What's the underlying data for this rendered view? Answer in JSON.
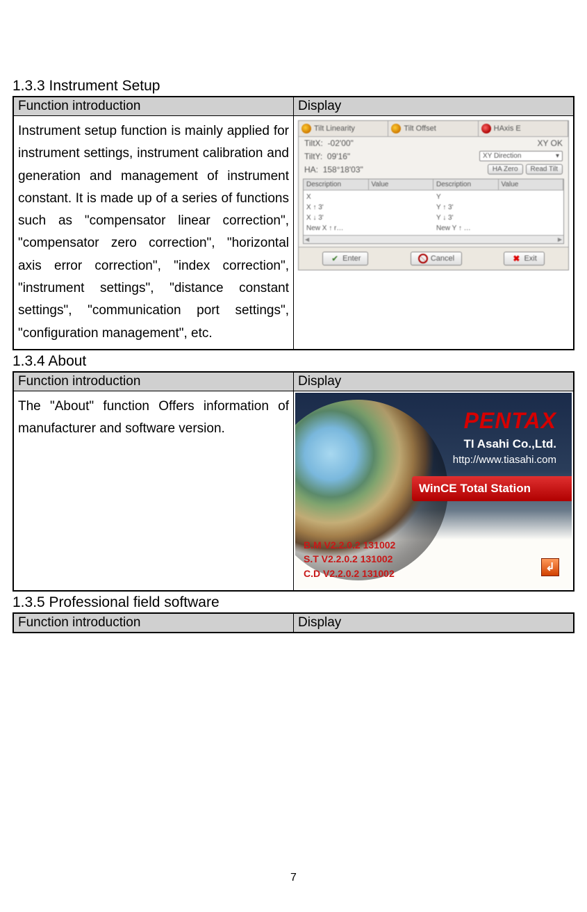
{
  "sections": {
    "s1": {
      "heading": "1.3.3 Instrument Setup",
      "th1": "Function introduction",
      "th2": "Display",
      "intro": "Instrument setup function is mainly applied for instrument settings, instrument calibration and generation and management of instrument constant. It is made up of a series of functions such as \"compensator linear correction\", \"compensator zero correction\", \"horizontal axis error correction\", \"index correction\", \"instrument settings\", \"distance constant settings\", \"communication port settings\", \"configuration management\", etc."
    },
    "s2": {
      "heading": "1.3.4 About",
      "th1": "Function introduction",
      "th2": "Display",
      "intro": "The \"About\" function Offers information of manufacturer and software version."
    },
    "s3": {
      "heading": "1.3.5 Professional field software",
      "th1": "Function introduction",
      "th2": "Display"
    }
  },
  "disp1": {
    "tabs": {
      "t1": "Tilt Linearity",
      "t2": "Tilt Offset",
      "t3": "HAxis E"
    },
    "read": {
      "tiltx_l": "TiltX:",
      "tiltx_v": "-02'00\"",
      "tilty_l": "TiltY:",
      "tilty_v": "09'16\"",
      "ha_l": "HA:",
      "ha_v": "158°18'03\"",
      "xyok": "XY OK",
      "dropdown": "XY Direction",
      "btn_hazero": "HA Zero",
      "btn_readtilt": "Read Tilt"
    },
    "grid": {
      "h1": "Description",
      "h2": "Value",
      "h3": "Description",
      "h4": "Value",
      "left": [
        "X",
        "X ↑ 3'",
        "X ↓ 3'",
        "New X ↑ r…"
      ],
      "right": [
        "Y",
        "Y ↑ 3'",
        "Y ↓ 3'",
        "New Y ↑ …"
      ]
    },
    "btns": {
      "enter": "Enter",
      "cancel": "Cancel",
      "exit": "Exit"
    }
  },
  "disp2": {
    "brand": "PENTAX",
    "company": "TI Asahi Co.,Ltd.",
    "url": "http://www.tiasahi.com",
    "bar": "WinCE Total Station",
    "v1": "B.M V2.2.0.2 131002",
    "v2": "S.T V2.2.0.2 131002",
    "v3": "C.D V2.2.0.2 131002"
  },
  "page": "7"
}
